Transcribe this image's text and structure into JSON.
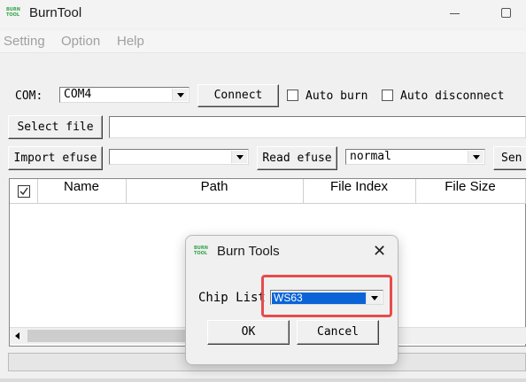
{
  "window": {
    "app_logo_text": "BURN TOOL",
    "title": "BurnTool"
  },
  "menu": [
    "Setting",
    "Option",
    "Help"
  ],
  "toolbar": {
    "com_label": "COM:",
    "com_value": "COM4",
    "connect_label": "Connect",
    "auto_burn_label": "Auto burn",
    "auto_disconnect_label": "Auto disconnect",
    "select_file_label": "Select file",
    "file_path_value": "",
    "import_efuse_label": "Import efuse",
    "efuse_value": "",
    "read_efuse_label": "Read efuse",
    "mode_value": "normal",
    "send_label_partial": "Sen"
  },
  "table": {
    "columns": [
      "Name",
      "Path",
      "File Index",
      "File Size"
    ]
  },
  "dialog": {
    "title": "Burn Tools",
    "chip_list_label": "Chip List",
    "chip_value": "WS63",
    "ok_label": "OK",
    "cancel_label": "Cancel"
  },
  "colors": {
    "highlight": "#e74c4c",
    "selection": "#0a64d8"
  }
}
